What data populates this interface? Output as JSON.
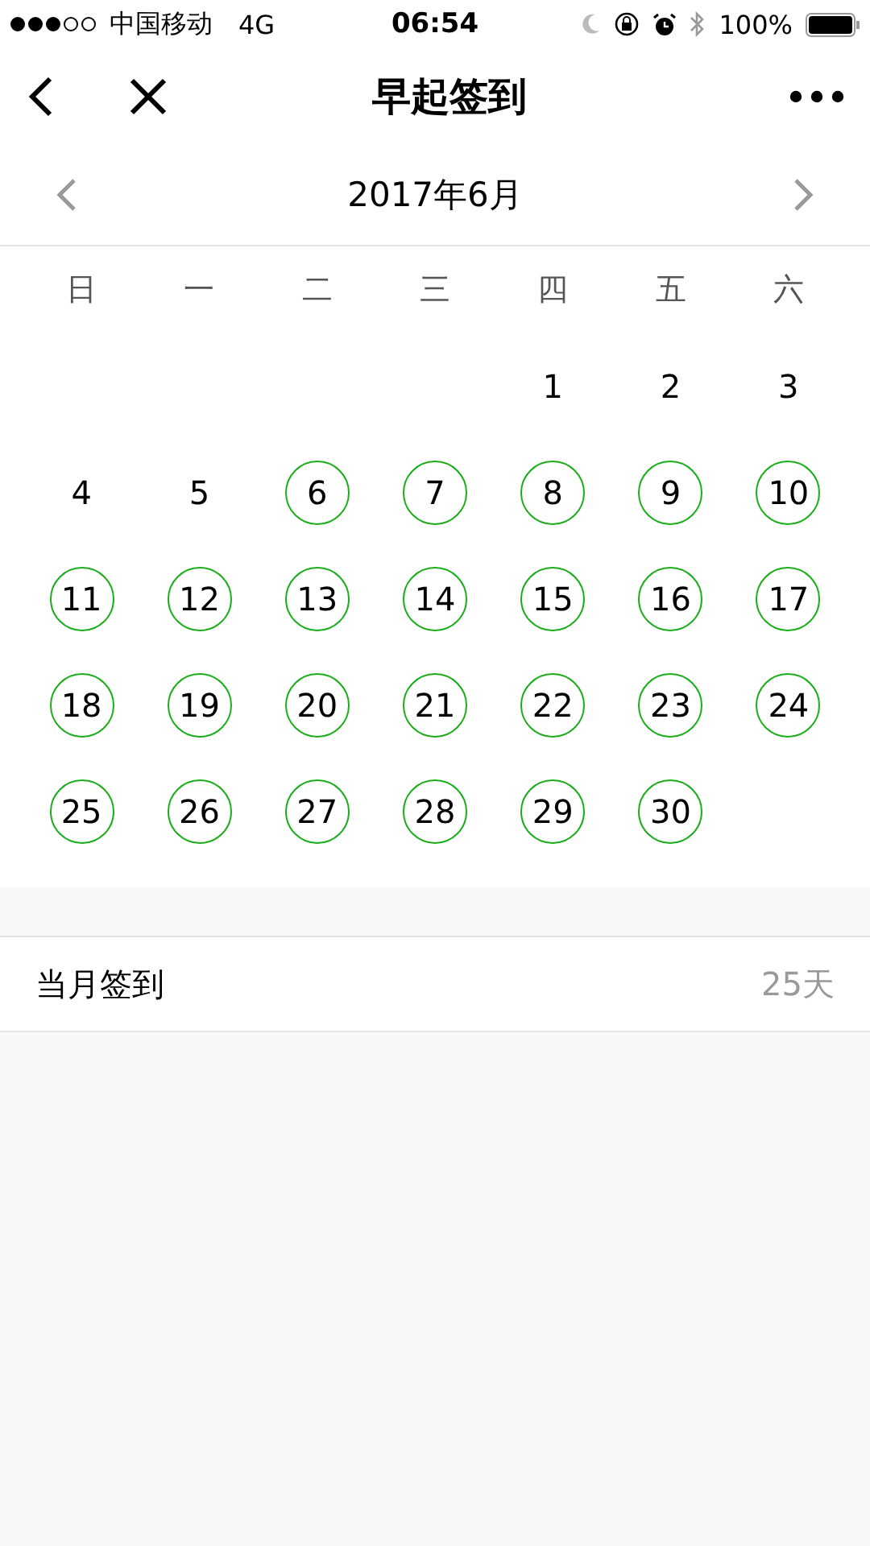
{
  "status_bar": {
    "carrier": "中国移动",
    "network": "4G",
    "time": "06:54",
    "battery": "100%"
  },
  "nav": {
    "title": "早起签到"
  },
  "calendar": {
    "month": "2017年6月",
    "weekdays": [
      "日",
      "一",
      "二",
      "三",
      "四",
      "五",
      "六"
    ],
    "weeks": [
      [
        {
          "kind": "empty"
        },
        {
          "kind": "empty"
        },
        {
          "kind": "empty"
        },
        {
          "kind": "empty"
        },
        {
          "kind": "day",
          "day": "1",
          "checked": false
        },
        {
          "kind": "day",
          "day": "2",
          "checked": false
        },
        {
          "kind": "day",
          "day": "3",
          "checked": false
        }
      ],
      [
        {
          "kind": "day",
          "day": "4",
          "checked": false
        },
        {
          "kind": "day",
          "day": "5",
          "checked": false
        },
        {
          "kind": "day",
          "day": "6",
          "checked": true
        },
        {
          "kind": "day",
          "day": "7",
          "checked": true
        },
        {
          "kind": "day",
          "day": "8",
          "checked": true
        },
        {
          "kind": "day",
          "day": "9",
          "checked": true
        },
        {
          "kind": "day",
          "day": "10",
          "checked": true
        }
      ],
      [
        {
          "kind": "day",
          "day": "11",
          "checked": true
        },
        {
          "kind": "day",
          "day": "12",
          "checked": true
        },
        {
          "kind": "day",
          "day": "13",
          "checked": true
        },
        {
          "kind": "day",
          "day": "14",
          "checked": true
        },
        {
          "kind": "day",
          "day": "15",
          "checked": true
        },
        {
          "kind": "day",
          "day": "16",
          "checked": true
        },
        {
          "kind": "day",
          "day": "17",
          "checked": true
        }
      ],
      [
        {
          "kind": "day",
          "day": "18",
          "checked": true
        },
        {
          "kind": "day",
          "day": "19",
          "checked": true
        },
        {
          "kind": "day",
          "day": "20",
          "checked": true
        },
        {
          "kind": "day",
          "day": "21",
          "checked": true
        },
        {
          "kind": "day",
          "day": "22",
          "checked": true
        },
        {
          "kind": "day",
          "day": "23",
          "checked": true
        },
        {
          "kind": "day",
          "day": "24",
          "checked": true
        }
      ],
      [
        {
          "kind": "day",
          "day": "25",
          "checked": true
        },
        {
          "kind": "day",
          "day": "26",
          "checked": true
        },
        {
          "kind": "day",
          "day": "27",
          "checked": true
        },
        {
          "kind": "day",
          "day": "28",
          "checked": true
        },
        {
          "kind": "day",
          "day": "29",
          "checked": true
        },
        {
          "kind": "day",
          "day": "30",
          "checked": true
        },
        {
          "kind": "empty"
        }
      ]
    ]
  },
  "summary": {
    "label": "当月签到",
    "value": "25天"
  }
}
